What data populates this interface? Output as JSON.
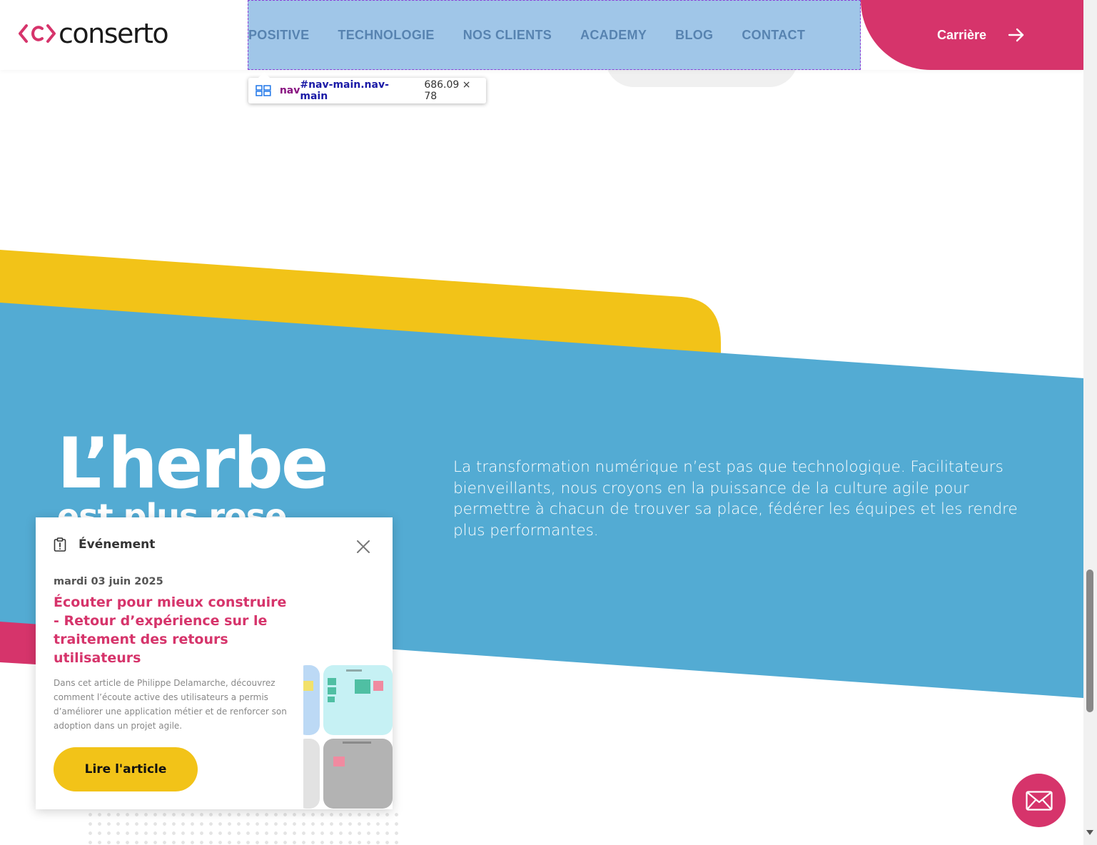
{
  "header": {
    "brand": "conserto",
    "nav": [
      {
        "label": "POSITIVE"
      },
      {
        "label": "TECHNOLOGIE"
      },
      {
        "label": "NOS CLIENTS"
      },
      {
        "label": "ACADEMY"
      },
      {
        "label": "BLOG"
      },
      {
        "label": "CONTACT"
      }
    ],
    "career_label": "Carrière"
  },
  "inspector": {
    "tag": "nav",
    "selector": "#nav-main.nav-main",
    "size": "686.09 × 78"
  },
  "hero": {
    "title_line1": "L’herbe",
    "title_line2": "est plus rose",
    "paragraph": "La transformation numérique n’est pas que technologique. Facilitateurs bienveillants, nous croyons en la puissance de la culture agile pour permettre à chacun de trouver sa place, fédérer les équipes et les rendre plus performantes."
  },
  "popup": {
    "header_label": "Événement",
    "date": "mardi 03 juin 2025",
    "title": "Écouter pour mieux construire - Retour d’expérience sur le traitement des retours utilisateurs",
    "description": "Dans cet article de Philippe Delamarche, découvrez comment l’écoute active des utilisateurs a permis d’améliorer une application métier et de renforcer son adoption dans un projet agile.",
    "button_label": "Lire l'article"
  },
  "colors": {
    "brand_pink": "#d6346b",
    "sky_blue": "#53abd3",
    "yellow": "#f2c318",
    "nav_text": "#2b3b5c"
  },
  "icons": {
    "logo_mark": "chevrons-logo-icon",
    "career_arrow": "arrow-right-icon",
    "popup_header": "clipboard-alert-icon",
    "popup_close": "close-icon",
    "fab": "mail-icon"
  }
}
